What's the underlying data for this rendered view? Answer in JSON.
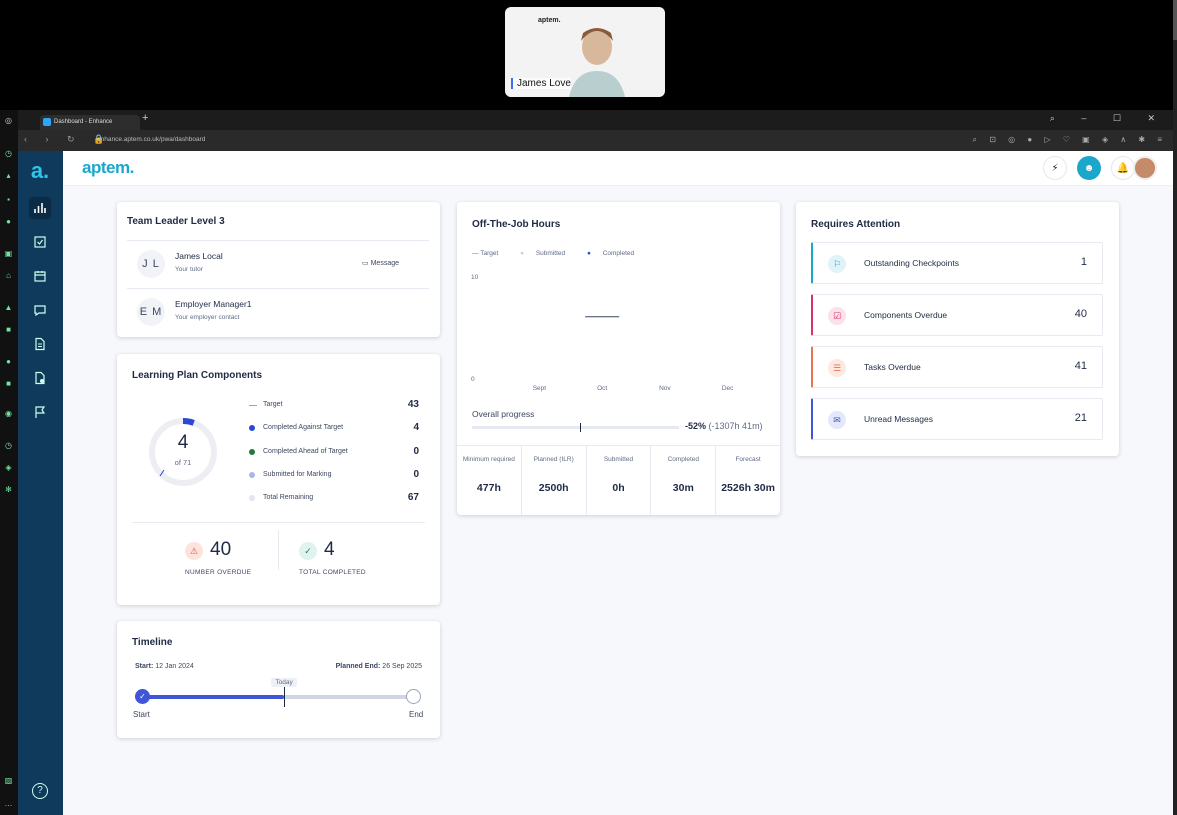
{
  "video": {
    "logo": "aptem.",
    "name": "James Love"
  },
  "browser": {
    "tab_title": "Dashboard - Enhance",
    "url": "enhance.aptem.co.uk/pwa/dashboard"
  },
  "app": {
    "brand": "aptem.",
    "side_logo": "a.",
    "help": "?"
  },
  "team": {
    "title": "Team Leader Level 3",
    "people": [
      {
        "initials": "J L",
        "name": "James Local",
        "role": "Your tutor"
      },
      {
        "initials": "E M",
        "name": "Employer Manager1",
        "role": "Your employer contact"
      }
    ],
    "message_label": "Message"
  },
  "lp": {
    "title": "Learning Plan Components",
    "donut_value": "4",
    "donut_sub": "of 71",
    "legend": [
      {
        "label": "Target",
        "value": "43",
        "color": "#9aa3b8"
      },
      {
        "label": "Completed Against Target",
        "value": "4",
        "color": "#2b48d6"
      },
      {
        "label": "Completed Ahead of Target",
        "value": "0",
        "color": "#1f7a3a"
      },
      {
        "label": "Submitted for Marking",
        "value": "0",
        "color": "#a9b6e8"
      },
      {
        "label": "Total Remaining",
        "value": "67",
        "color": "#e3e6ee"
      }
    ],
    "overdue_value": "40",
    "overdue_label": "NUMBER OVERDUE",
    "completed_value": "4",
    "completed_label": "TOTAL COMPLETED"
  },
  "timeline": {
    "title": "Timeline",
    "start_key": "Start:",
    "start_date": "12 Jan 2024",
    "end_key": "Planned End:",
    "end_date": "26 Sep 2025",
    "today": "Today",
    "start_label": "Start",
    "end_label": "End",
    "progress": 0.52
  },
  "otj": {
    "title": "Off-The-Job Hours",
    "legend": [
      "Target",
      "Submitted",
      "Completed"
    ],
    "overall_label": "Overall progress",
    "overall_pct": "-52%",
    "overall_detail": "(-1307h 41m)",
    "cells": [
      {
        "label": "Minimum required",
        "value": "477h"
      },
      {
        "label": "Planned (ILR)",
        "value": "2500h"
      },
      {
        "label": "Submitted",
        "value": "0h"
      },
      {
        "label": "Completed",
        "value": "30m"
      },
      {
        "label": "Forecast",
        "value": "2526h 30m"
      }
    ]
  },
  "chart_data": {
    "type": "line",
    "categories": [
      "Sept",
      "Oct",
      "Nov",
      "Dec"
    ],
    "series": [
      {
        "name": "Target",
        "values": [
          null,
          6,
          null,
          null
        ]
      },
      {
        "name": "Submitted",
        "values": [
          null,
          null,
          null,
          null
        ]
      },
      {
        "name": "Completed",
        "values": [
          null,
          null,
          null,
          null
        ]
      }
    ],
    "ylim": [
      0,
      10
    ],
    "yticks": [
      "0",
      "10"
    ],
    "title": "",
    "xlabel": "",
    "ylabel": ""
  },
  "attention": {
    "title": "Requires Attention",
    "rows": [
      {
        "label": "Outstanding Checkpoints",
        "value": "1",
        "color": "#1aa7c9"
      },
      {
        "label": "Components Overdue",
        "value": "40",
        "color": "#d6336c"
      },
      {
        "label": "Tasks Overdue",
        "value": "41",
        "color": "#e8744c"
      },
      {
        "label": "Unread Messages",
        "value": "21",
        "color": "#3f56d6"
      }
    ]
  },
  "colors": {
    "sidebar": "#0f3a5c",
    "accent": "#1aa7c9",
    "completed": "#2b48d6"
  }
}
